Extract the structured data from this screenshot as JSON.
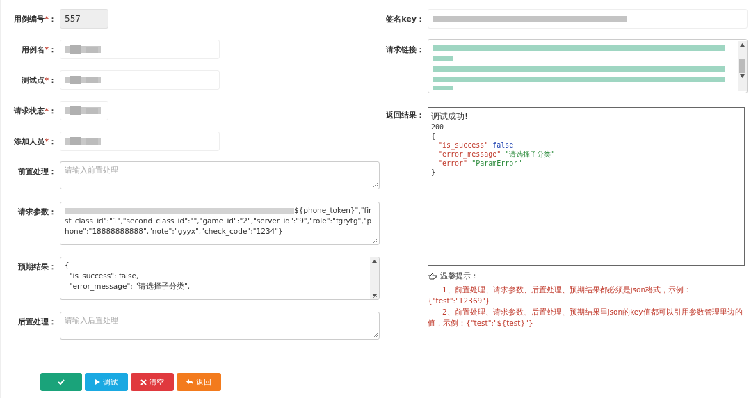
{
  "left_fields": [
    {
      "label": "用例编号",
      "mark": "*",
      "colon": "：",
      "kind": "narrow",
      "value": "557",
      "readonly": true
    },
    {
      "label": "用例名",
      "mark": "*",
      "colon": "：",
      "kind": "input",
      "redacted": true
    },
    {
      "label": "测试点",
      "mark": "*",
      "colon": "：",
      "kind": "input",
      "redacted": true
    },
    {
      "label": "请求状态",
      "mark": "*",
      "colon": "：",
      "kind": "narrow",
      "redacted": true
    },
    {
      "label": "添加人员",
      "mark": "*",
      "colon": "：",
      "kind": "input",
      "redacted": true
    },
    {
      "label": "前置处理",
      "colon": "：",
      "kind": "textarea",
      "placeholder": "请输入前置处理"
    },
    {
      "label": "请求参数",
      "colon": "：",
      "kind": "textarea",
      "redacted_prefix": true,
      "lines": [
        "${phone_token}\",\"first_class_id\":\"1\",\"second_class_id\":\"\",\"game_id\":\"2\",\"server_id\":\"9\",\"role\":\"fgrytg\",\"phone\":\"18888888888\",\"note\":\"gyyx\",\"check_code\":\"1234\"}"
      ]
    },
    {
      "label": "预期结果",
      "colon": "：",
      "kind": "textarea",
      "lines": [
        "{",
        "  \"is_success\": false,",
        "  \"error_message\": \"请选择子分类\","
      ],
      "scrollbar": true
    },
    {
      "label": "后置处理",
      "colon": "：",
      "kind": "textarea",
      "placeholder": "请输入后置处理"
    }
  ],
  "right_fields": [
    {
      "label": "签名key",
      "colon": "：",
      "kind": "key"
    },
    {
      "label": "请求链接",
      "colon": "：",
      "kind": "link"
    }
  ],
  "result": {
    "label": "返回结果",
    "colon": "：",
    "title": "调试成功!",
    "status": "200",
    "open": "{",
    "entries": [
      {
        "key": "\"is_success\"",
        "value": "false",
        "kind": "bool"
      },
      {
        "key": "\"error_message\"",
        "value": "\"请选择子分类\"",
        "kind": "string"
      },
      {
        "key": "\"error\"",
        "value": "\"ParamError\"",
        "kind": "string"
      }
    ],
    "close": "}"
  },
  "tips": {
    "title": "温馨提示：",
    "lines": [
      "1、前置处理、请求参数、后置处理、预期结果都必须是json格式，示例：{\"test\":\"12369\"}",
      "2、前置处理、请求参数、后置处理、预期结果里json的key值都可以引用参数管理里边的值，示例：{\"test\":\"${test}\"}"
    ]
  },
  "buttons": [
    {
      "kind": "save",
      "color": "#1aa37a"
    },
    {
      "kind": "debug",
      "label": "调试",
      "color": "#1aa9e2"
    },
    {
      "kind": "clear",
      "label": "清空",
      "color": "#e0393e"
    },
    {
      "kind": "back",
      "label": "返回",
      "color": "#f37b1d"
    }
  ]
}
